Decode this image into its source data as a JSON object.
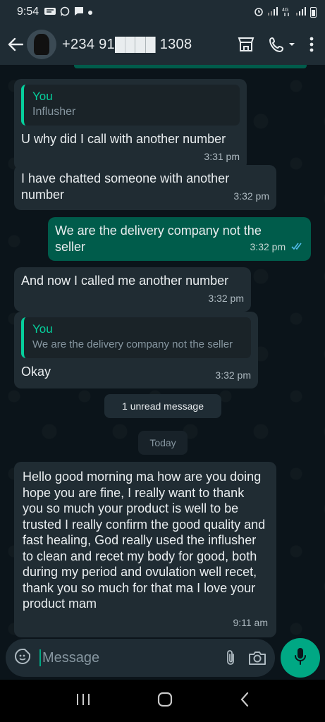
{
  "status_bar": {
    "time": "9:54",
    "icons_left": [
      "notification-icon",
      "whatsapp-icon",
      "message-icon",
      "dot-icon"
    ],
    "icons_right": [
      "alarm-icon",
      "signal-icon",
      "4g-icon",
      "signal-icon",
      "battery-icon"
    ]
  },
  "header": {
    "contact_name": "+234 91████ 1308"
  },
  "messages": [
    {
      "direction": "in",
      "quote": {
        "name": "You",
        "text": "Influsher"
      },
      "text": "U why did I call with another number",
      "time": "3:31 pm"
    },
    {
      "direction": "in",
      "text": "I have chatted someone with another number",
      "time": "3:32 pm"
    },
    {
      "direction": "out",
      "text": "We are the delivery company not the seller",
      "time": "3:32 pm",
      "status": "read"
    },
    {
      "direction": "in",
      "text": "And now I called me another number",
      "time": "3:32 pm"
    },
    {
      "direction": "in",
      "quote": {
        "name": "You",
        "text": "We are the delivery company not the seller"
      },
      "text": "Okay",
      "time": "3:32 pm"
    },
    {
      "direction": "in",
      "text": "Hello good morning ma how are you doing hope you are fine, I really want to thank you so much your product is well to be trusted I really confirm the good quality and fast healing, God really used the influsher to clean and recet my body for  good, both during my period and ovulation well recet, thank you so much for that ma I love your product mam",
      "time": "9:11 am"
    }
  ],
  "unread_label": "1 unread message",
  "date_label": "Today",
  "composer": {
    "placeholder": "Message"
  },
  "colors": {
    "accent": "#00a884",
    "incoming_bubble": "#202c33",
    "outgoing_bubble": "#005c4b",
    "read_ticks": "#53bdeb"
  }
}
